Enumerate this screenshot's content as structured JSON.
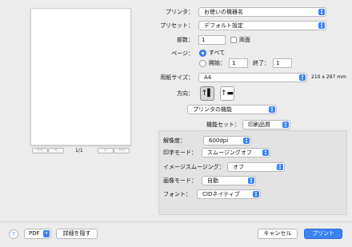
{
  "printer": {
    "label": "プリンタ：",
    "value": "お使いの機器名"
  },
  "preset": {
    "label": "プリセット：",
    "value": "デフォルト設定"
  },
  "copies": {
    "label": "部数：",
    "value": "1",
    "duplex_label": "両面"
  },
  "pages": {
    "label": "ページ：",
    "all_label": "すべて",
    "from_label": "開始：",
    "from_value": "1",
    "to_label": "終了：",
    "to_value": "1"
  },
  "paper": {
    "label": "用紙サイズ：",
    "value": "A4",
    "dimensions": "210 x 297 mm"
  },
  "orientation": {
    "label": "方向："
  },
  "section_select": {
    "value": "プリンタの機能"
  },
  "feature_set": {
    "label": "機能セット：",
    "value": "印刷品質"
  },
  "features": [
    {
      "label": "解像度：",
      "value": "600dpi"
    },
    {
      "label": "印字モード：",
      "value": "スムージングオフ"
    },
    {
      "label": "イメージスムージング：",
      "value": "オフ"
    },
    {
      "label": "画像モード：",
      "value": "自動"
    },
    {
      "label": "フォント：",
      "value": "CIDネイティブ"
    }
  ],
  "preview_nav": {
    "first": "<<",
    "prev": "<",
    "page_indicator": "1/1",
    "next": ">",
    "last": ">>"
  },
  "footer": {
    "help": "?",
    "pdf_label": "PDF",
    "details_label": "詳細を隠す",
    "cancel_label": "キャンセル",
    "print_label": "プリント"
  },
  "colors": {
    "accent": "#3a82f7",
    "window_bg": "#ececec",
    "inset_panel": "#e3e3e3"
  }
}
